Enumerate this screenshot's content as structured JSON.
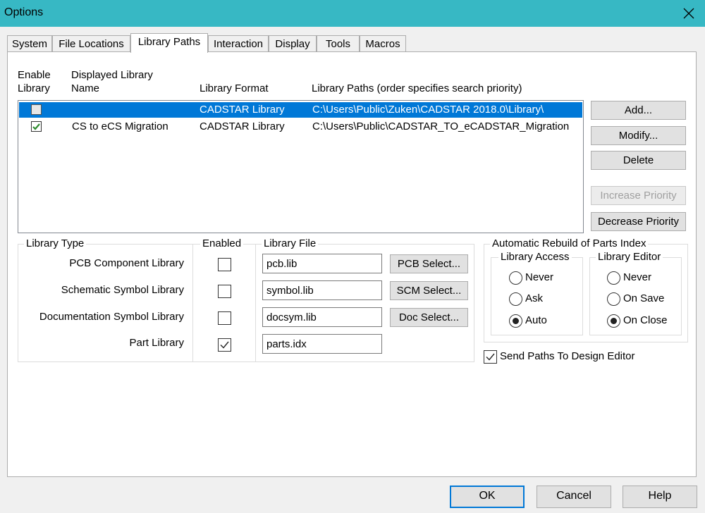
{
  "window": {
    "title": "Options"
  },
  "tabs": [
    "System",
    "File Locations",
    "Library Paths",
    "Interaction",
    "Display",
    "Tools",
    "Macros"
  ],
  "active_tab": "Library Paths",
  "list_headers": {
    "enable_1": "Enable",
    "enable_2": "Library",
    "name_1": "Displayed Library",
    "name_2": "Name",
    "format": "Library Format",
    "paths": "Library Paths (order specifies search priority)"
  },
  "libraries": [
    {
      "enabled": false,
      "name": "",
      "format": "CADSTAR Library",
      "path": "C:\\Users\\Public\\Zuken\\CADSTAR 2018.0\\Library\\",
      "selected": true
    },
    {
      "enabled": true,
      "name": "CS to eCS Migration",
      "format": "CADSTAR Library",
      "path": "C:\\Users\\Public\\CADSTAR_TO_eCADSTAR_Migration",
      "selected": false
    }
  ],
  "side_buttons": {
    "add": "Add...",
    "modify": "Modify...",
    "delete": "Delete",
    "increase": "Increase Priority",
    "decrease": "Decrease Priority"
  },
  "library_type": {
    "legend": "Library Type",
    "enabled_legend": "Enabled",
    "file_legend": "Library File",
    "rows": [
      {
        "label": "PCB Component Library",
        "enabled": false,
        "file": "pcb.lib",
        "button": "PCB Select..."
      },
      {
        "label": "Schematic Symbol Library",
        "enabled": false,
        "file": "symbol.lib",
        "button": "SCM Select..."
      },
      {
        "label": "Documentation Symbol Library",
        "enabled": false,
        "file": "docsym.lib",
        "button": "Doc Select..."
      },
      {
        "label": "Part Library",
        "enabled": true,
        "file": "parts.idx",
        "button": ""
      }
    ]
  },
  "rebuild": {
    "legend": "Automatic Rebuild of Parts Index",
    "access_legend": "Library Access",
    "editor_legend": "Library Editor",
    "access_options": [
      "Never",
      "Ask",
      "Auto"
    ],
    "access_selected": "Auto",
    "editor_options": [
      "Never",
      "On Save",
      "On Close"
    ],
    "editor_selected": "On Close"
  },
  "send_paths": {
    "label": "Send Paths To Design Editor",
    "checked": true
  },
  "dialog_buttons": {
    "ok": "OK",
    "cancel": "Cancel",
    "help": "Help"
  },
  "colors": {
    "titlebar": "#37b8c4",
    "selection": "#0078d7",
    "check_green": "#2e8b2e"
  }
}
